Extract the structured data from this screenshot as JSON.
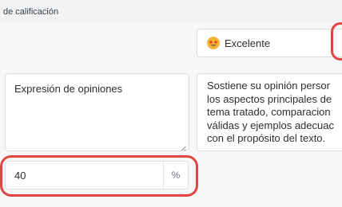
{
  "section": {
    "title": "de calificación"
  },
  "rating": {
    "selected_label": "Excelente",
    "icon": "star-struck-emoji-icon"
  },
  "criterion": {
    "text": "Expresión de opiniones"
  },
  "description": {
    "lines": [
      "Sostiene su opinión persor",
      "los aspectos principales de",
      "tema tratado, comparacion",
      "válidas y ejemplos adecuac",
      "con el propósito del texto."
    ]
  },
  "weight": {
    "value": "40",
    "suffix": "%"
  },
  "colors": {
    "highlight": "#e0463f",
    "field_border": "#d9dde2"
  }
}
